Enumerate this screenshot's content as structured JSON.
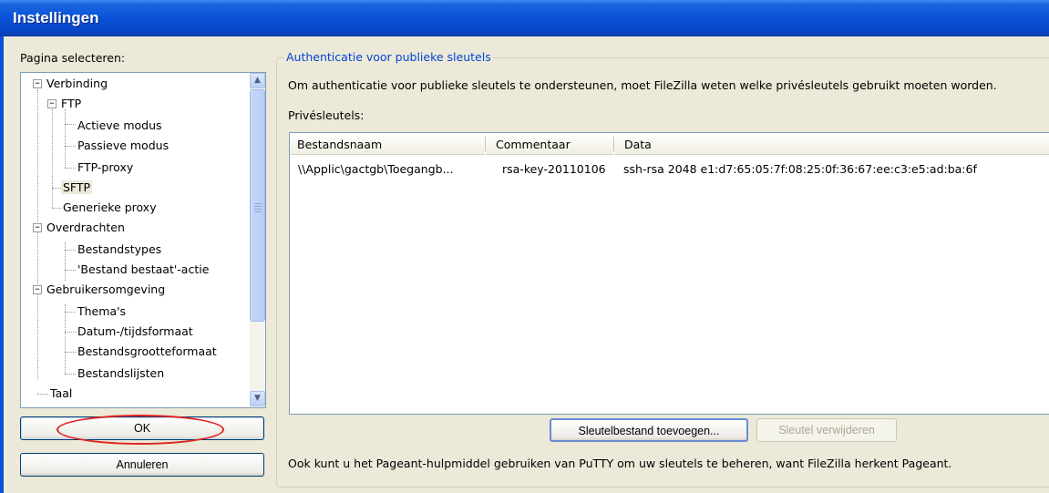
{
  "window": {
    "title": "Instellingen"
  },
  "page_select": {
    "label": "Pagina selecteren:"
  },
  "tree": {
    "verbinding": "Verbinding",
    "ftp": "FTP",
    "actieve_modus": "Actieve modus",
    "passieve_modus": "Passieve modus",
    "ftp_proxy": "FTP-proxy",
    "sftp": "SFTP",
    "generieke_proxy": "Generieke proxy",
    "overdrachten": "Overdrachten",
    "bestandstypes": "Bestandstypes",
    "bestand_bestaat": "'Bestand bestaat'-actie",
    "gebruikersomgeving": "Gebruikersomgeving",
    "themas": "Thema's",
    "datum_tijd": "Datum-/tijdsformaat",
    "bestandsgrootte": "Bestandsgrootteformaat",
    "bestandslijsten": "Bestandslijsten",
    "taal": "Taal",
    "selected": "SFTP"
  },
  "buttons": {
    "ok": "OK",
    "cancel": "Annuleren",
    "add_key": "Sleutelbestand toevoegen...",
    "remove_key": "Sleutel verwijderen"
  },
  "auth": {
    "group_title": "Authenticatie voor publieke sleutels",
    "description": "Om authenticatie voor publieke sleutels te ondersteunen, moet FileZilla weten welke privésleutels gebruikt moeten worden.",
    "keys_label": "Privésleutels:",
    "footer": "Ook kunt u het Pageant-hulpmiddel gebruiken van PuTTY om uw sleutels te beheren, want FileZilla herkent Pageant."
  },
  "table": {
    "columns": [
      "Bestandsnaam",
      "Commentaar",
      "Data"
    ],
    "rows": [
      {
        "file": "\\\\Applic\\gactgb\\Toegangb...",
        "comment": "rsa-key-20110106",
        "data": "ssh-rsa 2048 e1:d7:65:05:7f:08:25:0f:36:67:ee:c3:e5:ad:ba:6f"
      }
    ]
  },
  "colors": {
    "titlebar": "#0a52d8",
    "group_title": "#0046d5",
    "annotation": "#e0241f",
    "background": "#ece9d8"
  }
}
